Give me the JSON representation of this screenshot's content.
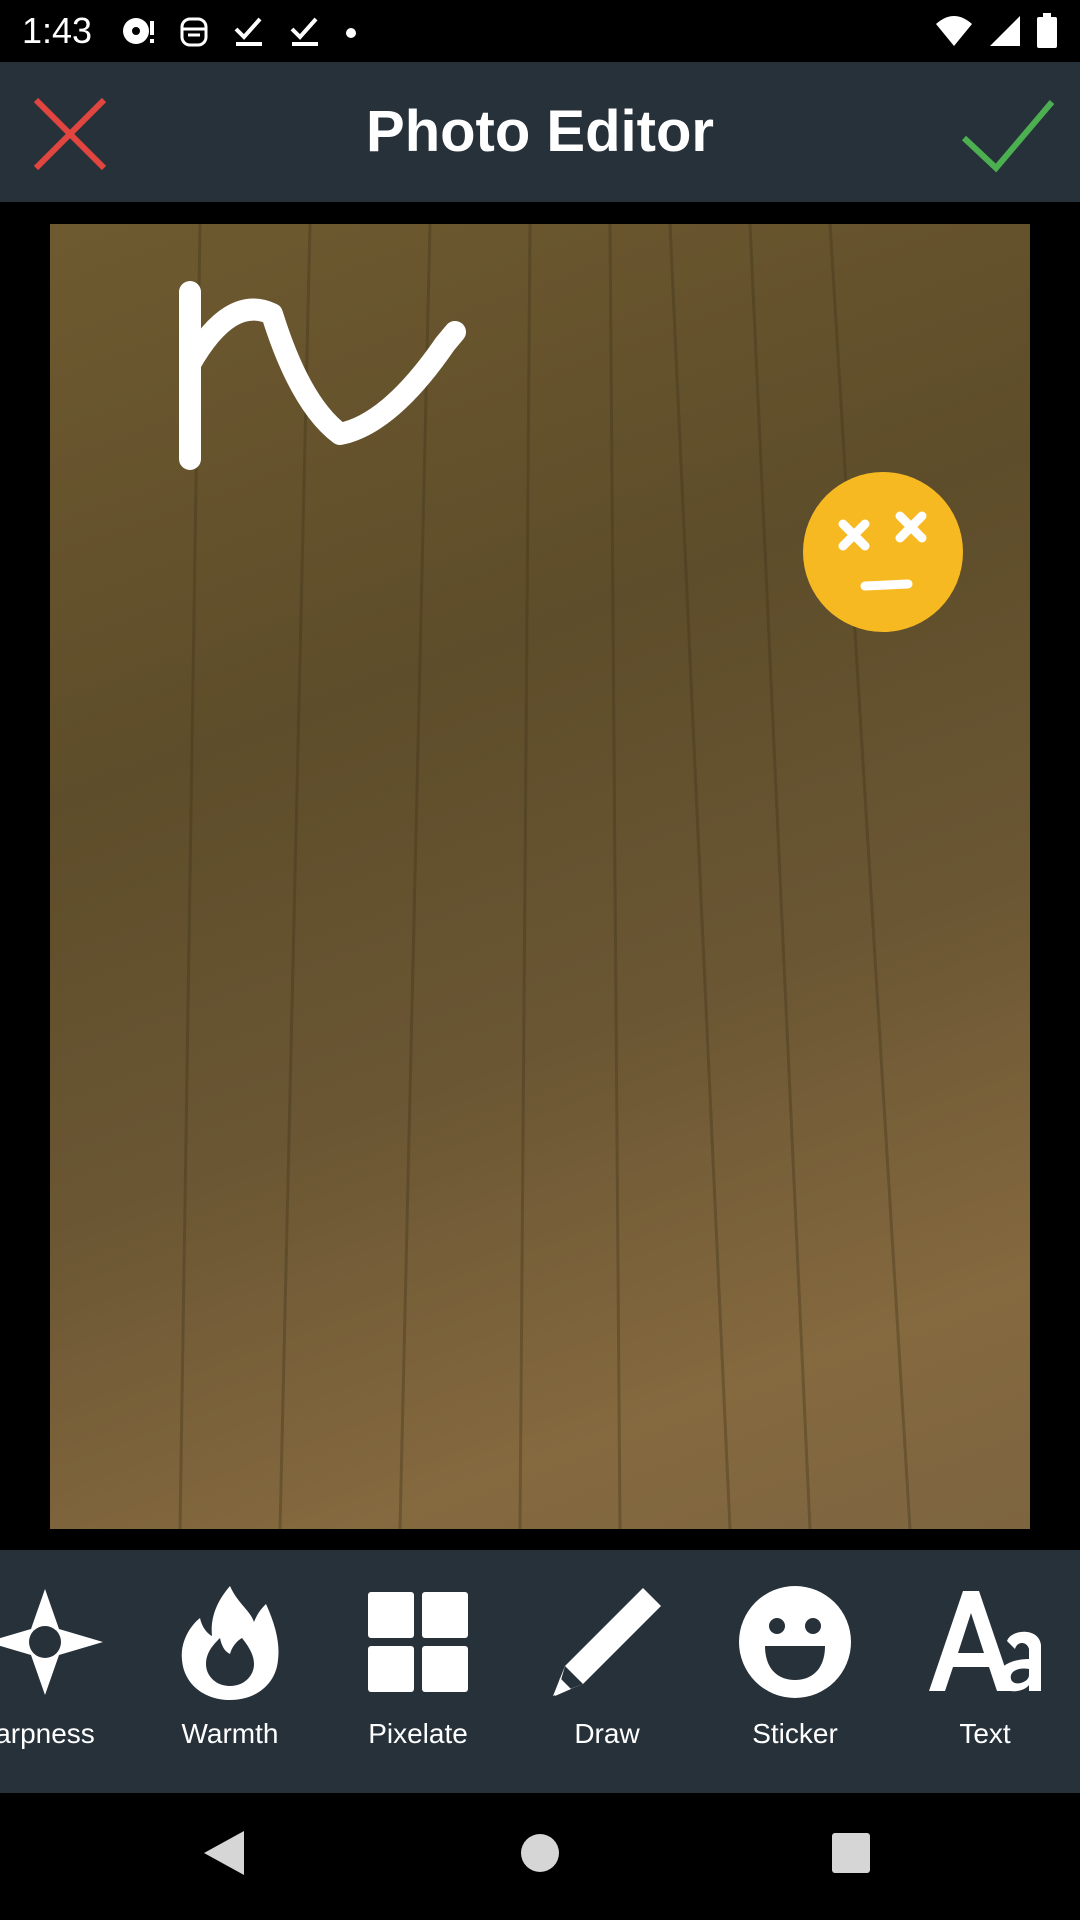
{
  "status_bar": {
    "time": "1:43",
    "left_icons": [
      "media-icon",
      "android-icon",
      "download-done-icon",
      "download-done-icon",
      "dot-icon"
    ],
    "right_icons": [
      "wifi-icon",
      "signal-icon",
      "battery-icon"
    ]
  },
  "app_bar": {
    "title": "Photo Editor",
    "close_icon": "close-icon",
    "confirm_icon": "check-icon",
    "close_color": "#e0453f",
    "confirm_color": "#4caf50"
  },
  "canvas": {
    "drawing": "freehand-stroke",
    "sticker": "dizzy-face-emoji",
    "sticker_color": "#f7b922"
  },
  "toolbar": {
    "tools": [
      {
        "label": "Sharpness",
        "visible_label": "arpness",
        "icon": "sharpness-icon"
      },
      {
        "label": "Warmth",
        "icon": "flame-icon"
      },
      {
        "label": "Pixelate",
        "icon": "grid-icon"
      },
      {
        "label": "Draw",
        "icon": "pencil-icon"
      },
      {
        "label": "Sticker",
        "icon": "smiley-icon"
      },
      {
        "label": "Text",
        "icon": "text-icon"
      }
    ]
  },
  "nav_bar": {
    "back": "back-icon",
    "home": "home-icon",
    "recents": "recents-icon"
  }
}
